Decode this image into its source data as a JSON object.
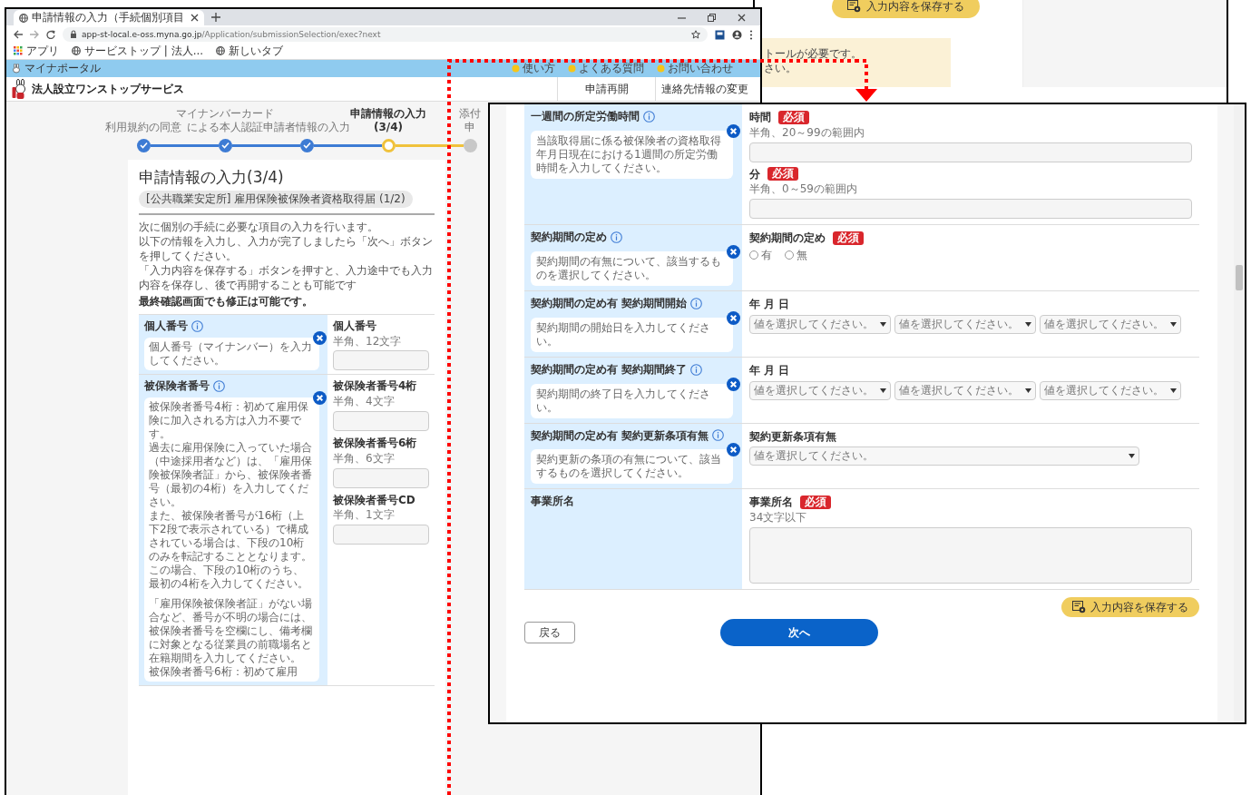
{
  "background_window": {
    "save_button": "入力内容を保存する",
    "notice_lines": [
      "トールが必要です。",
      "さい。"
    ]
  },
  "browser": {
    "tab_title": "申請情報の入力（手続個別項目",
    "url_host": "app-st-local.e-oss.myna.go.jp",
    "url_path": "/Application/submissionSelection/exec?next",
    "bookmarks": [
      {
        "kind": "apps",
        "label": "アプリ"
      },
      {
        "kind": "page",
        "label": "サービストップ | 法人..."
      },
      {
        "kind": "page",
        "label": "新しいタブ"
      }
    ]
  },
  "site": {
    "portal_label": "マイナポータル",
    "utility_links": [
      "使い方",
      "よくある質問",
      "お問い合わせ"
    ],
    "service_name": "法人設立ワンストップサービス",
    "nav": [
      "申請再開",
      "連絡先情報の変更"
    ]
  },
  "steps": [
    {
      "lines": [
        "利用規約の同意"
      ],
      "completed": true,
      "current": false
    },
    {
      "lines": [
        "マイナンバーカード",
        "による本人認証"
      ],
      "completed": true,
      "current": false
    },
    {
      "lines": [
        "申請者情報の入力"
      ],
      "completed": true,
      "current": false
    },
    {
      "lines": [
        "申請情報の入力",
        "(3/4)"
      ],
      "completed": false,
      "current": true
    },
    {
      "lines": [
        "添付",
        "申"
      ],
      "completed": false,
      "current": false
    }
  ],
  "page": {
    "title": "申請情報の入力(3/4)",
    "form_name": "[公共職業安定所] 雇用保険被保険者資格取得届 (1/2)",
    "intro": [
      "次に個別の手続に必要な項目の入力を行います。",
      "以下の情報を入力し、入力が完了しましたら「次へ」ボタンを押してください。",
      "「入力内容を保存する」ボタンを押すと、入力途中でも入力内容を保存し、後で再開することも可能です"
    ],
    "note": "最終確認画面でも修正は可能です。",
    "fields": [
      {
        "label": "個人番号",
        "info": true,
        "help": [
          [
            "個人番号（マイナンバー）を入力してください。"
          ]
        ],
        "inputs": [
          {
            "kind": "text",
            "label": "個人番号",
            "hint": "半角、12文字"
          }
        ]
      },
      {
        "label": "被保険者番号",
        "info": true,
        "help": [
          [
            "被保険者番号4桁：初めて雇用保険に加入される方は入力不要です。",
            "過去に雇用保険に入っていた場合（中途採用者など）は、「雇用保険被保険者証」から、被保険者番号（最初の4桁）を入力してください。",
            "また、被保険者番号が16桁（上下2段で表示されている）で構成されている場合は、下段の10桁のみを転記することとなります。この場合、下段の10桁のうち、最初の4桁を入力してください。"
          ],
          [
            "「雇用保険被保険者証」がない場合など、番号が不明の場合には、被保険者番号を空欄にし、備考欄に対象となる従業員の前職場名と在籍期間を入力してください。",
            "被保険者番号6桁：初めて雇用"
          ]
        ],
        "inputs": [
          {
            "kind": "text",
            "label": "被保険者番号4桁",
            "hint": "半角、4文字"
          },
          {
            "kind": "text",
            "label": "被保険者番号6桁",
            "hint": "半角、6文字"
          },
          {
            "kind": "text",
            "label": "被保険者番号CD",
            "hint": "半角、1文字"
          }
        ]
      }
    ]
  },
  "detail_window": {
    "fields": [
      {
        "label": "一週間の所定労働時間",
        "info": true,
        "help": [
          [
            "当該取得届に係る被保険者の資格取得年月日現在における1週間の所定労働時間を入力してください。"
          ]
        ],
        "inputs": [
          {
            "kind": "text",
            "label": "時間",
            "badge": "必須",
            "hint": "半角、20～99の範囲内"
          },
          {
            "kind": "text",
            "label": "分",
            "badge": "必須",
            "hint": "半角、0～59の範囲内"
          }
        ]
      },
      {
        "label": "契約期間の定め",
        "info": true,
        "help": [
          [
            "契約期間の有無について、該当するものを選択してください。"
          ]
        ],
        "inputs": [
          {
            "kind": "radio",
            "label": "契約期間の定め",
            "badge": "必須",
            "options": [
              {
                "label": "有",
                "checked": false
              },
              {
                "label": "無",
                "checked": false
              }
            ]
          }
        ]
      },
      {
        "label": "契約期間の定め有 契約期間開始",
        "info": true,
        "help": [
          [
            "契約期間の開始日を入力してください。"
          ]
        ],
        "inputs": [
          {
            "kind": "date",
            "label": "年 月 日",
            "selects": [
              "値を選択してください。",
              "値を選択してください。",
              "値を選択してください。"
            ]
          }
        ]
      },
      {
        "label": "契約期間の定め有 契約期間終了",
        "info": true,
        "help": [
          [
            "契約期間の終了日を入力してください。"
          ]
        ],
        "inputs": [
          {
            "kind": "date",
            "label": "年 月 日",
            "selects": [
              "値を選択してください。",
              "値を選択してください。",
              "値を選択してください。"
            ]
          }
        ]
      },
      {
        "label": "契約期間の定め有 契約更新条項有無",
        "info": true,
        "help": [
          [
            "契約更新の条項の有無について、該当するものを選択してください。"
          ]
        ],
        "inputs": [
          {
            "kind": "select",
            "label": "契約更新条項有無",
            "selects": [
              "値を選択してください。"
            ]
          }
        ]
      },
      {
        "label": "事業所名",
        "info": false,
        "inputs": [
          {
            "kind": "textarea",
            "label": "事業所名",
            "badge": "必須",
            "hint": "34文字以下"
          }
        ]
      }
    ],
    "save_button": "入力内容を保存する",
    "back_button": "戻る",
    "next_button": "次へ"
  }
}
